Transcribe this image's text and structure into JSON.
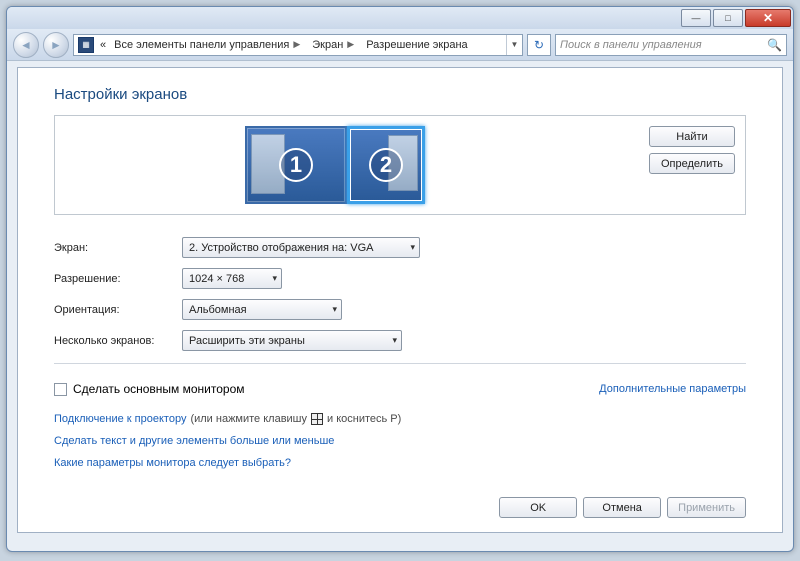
{
  "window": {
    "min_glyph": "—",
    "max_glyph": "□",
    "close_glyph": "✕"
  },
  "nav": {
    "back_glyph": "◄",
    "fwd_glyph": "►",
    "refresh_glyph": "↻",
    "addr_prefix": "«",
    "breadcrumb": [
      "Все элементы панели управления",
      "Экран",
      "Разрешение экрана"
    ],
    "search_placeholder": "Поиск в панели управления",
    "mag_glyph": "🔍"
  },
  "page": {
    "title": "Настройки экранов"
  },
  "preview": {
    "mon1": "1",
    "mon2": "2",
    "find": "Найти",
    "identify": "Определить"
  },
  "form": {
    "display_label": "Экран:",
    "display_value": "2. Устройство отображения на: VGA",
    "resolution_label": "Разрешение:",
    "resolution_value": "1024 × 768",
    "orientation_label": "Ориентация:",
    "orientation_value": "Альбомная",
    "multi_label": "Несколько экранов:",
    "multi_value": "Расширить эти экраны"
  },
  "chk": {
    "label": "Сделать основным монитором",
    "adv_link": "Дополнительные параметры"
  },
  "links": {
    "l1": "Подключение к проектору",
    "l1_suffix1": "(или нажмите клавишу",
    "l1_suffix2": "и коснитесь P)",
    "l2": "Сделать текст и другие элементы больше или меньше",
    "l3": "Какие параметры монитора следует выбрать?"
  },
  "buttons": {
    "ok": "OK",
    "cancel": "Отмена",
    "apply": "Применить"
  }
}
